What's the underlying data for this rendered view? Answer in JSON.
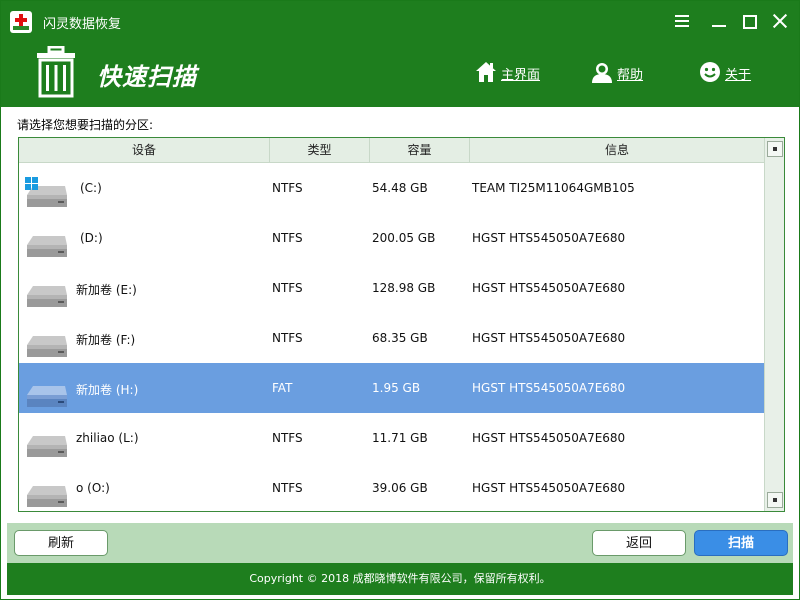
{
  "window": {
    "title": "闪灵数据恢复"
  },
  "header": {
    "title": "快速扫描",
    "nav": [
      {
        "label": "主界面",
        "icon": "home-icon"
      },
      {
        "label": "帮助",
        "icon": "user-help-icon"
      },
      {
        "label": "关于",
        "icon": "smiley-icon"
      }
    ]
  },
  "instruction": "请选择您想要扫描的分区:",
  "table": {
    "columns": [
      "设备",
      "类型",
      "容量",
      "信息"
    ],
    "rows": [
      {
        "device": "(C:)",
        "type": "NTFS",
        "size": "54.48 GB",
        "info": "TEAM TI25M11064GMB105"
      },
      {
        "device": "(D:)",
        "type": "NTFS",
        "size": "200.05 GB",
        "info": "HGST HTS545050A7E680"
      },
      {
        "device": "新加卷 (E:)",
        "type": "NTFS",
        "size": "128.98 GB",
        "info": "HGST HTS545050A7E680"
      },
      {
        "device": "新加卷 (F:)",
        "type": "NTFS",
        "size": "68.35 GB",
        "info": "HGST HTS545050A7E680"
      },
      {
        "device": "新加卷 (H:)",
        "type": "FAT",
        "size": "1.95 GB",
        "info": "HGST HTS545050A7E680"
      },
      {
        "device": "zhiliao (L:)",
        "type": "NTFS",
        "size": "11.71 GB",
        "info": "HGST HTS545050A7E680"
      },
      {
        "device": "o (O:)",
        "type": "NTFS",
        "size": "39.06 GB",
        "info": "HGST HTS545050A7E680"
      }
    ],
    "selected_row": "新加卷 (H:)"
  },
  "buttons": {
    "refresh": "刷新",
    "back": "返回",
    "scan": "扫描"
  },
  "footer": {
    "copyright": "Copyright © 2018 成都晓博软件有限公司，保留所有权利。"
  },
  "colors": {
    "brand_green": "#1e7e1e",
    "selection": "#6a9ee0",
    "scan_button": "#3a8ee6"
  }
}
